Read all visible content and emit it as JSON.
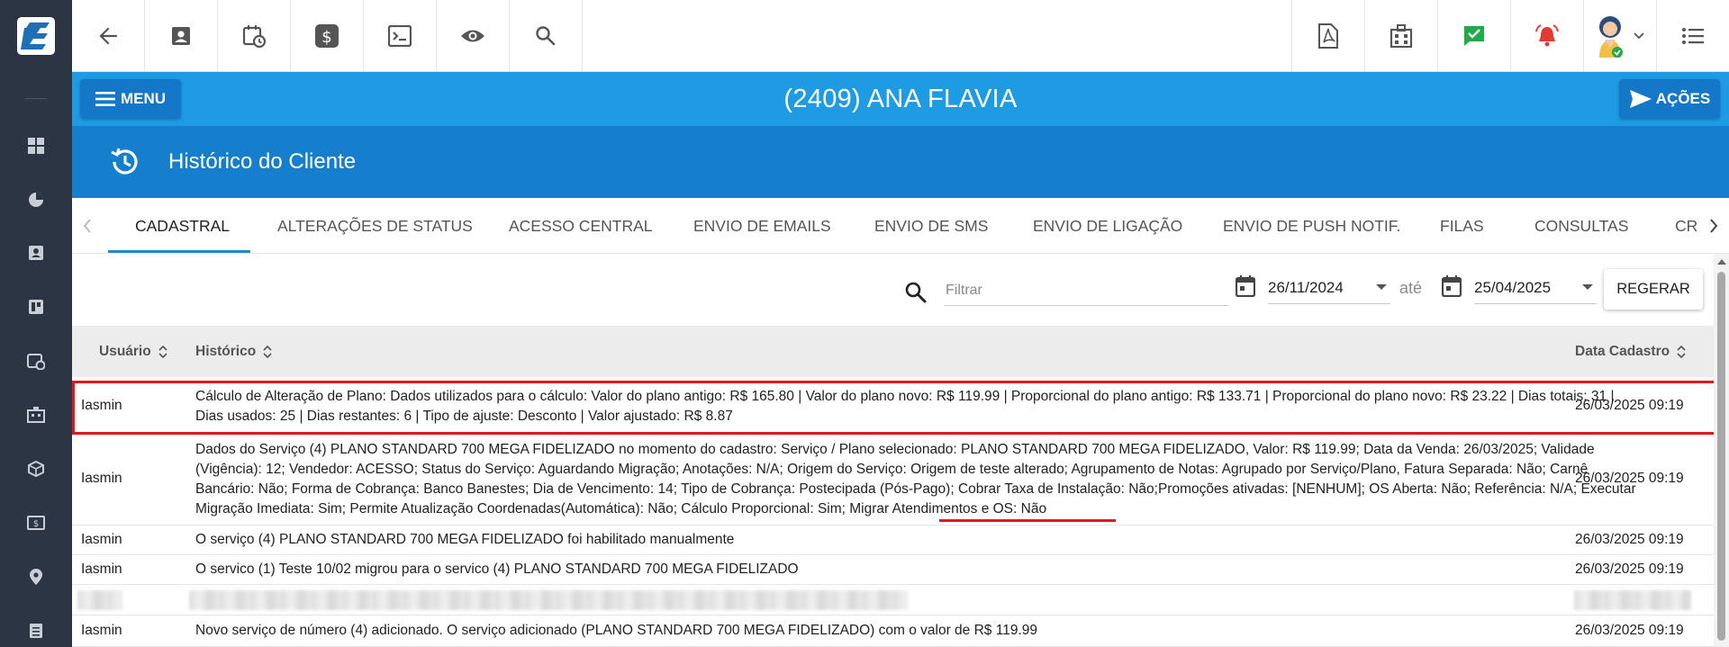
{
  "topbar": {
    "left_buttons": [
      {
        "icon": "arrow-left-icon"
      },
      {
        "icon": "contact-card-icon"
      },
      {
        "icon": "calendar-clock-icon"
      },
      {
        "icon": "dollar-icon"
      },
      {
        "icon": "terminal-icon"
      },
      {
        "icon": "eye-icon"
      },
      {
        "icon": "search-icon"
      }
    ],
    "right_buttons": [
      {
        "icon": "pdf-file-icon"
      },
      {
        "icon": "building-icon"
      },
      {
        "icon": "checkmark-message-icon",
        "color": "#22a94a"
      },
      {
        "icon": "alarm-bell-icon",
        "color": "#e53935"
      },
      {
        "icon": "avatar-icon"
      },
      {
        "icon": "list-icon"
      }
    ]
  },
  "header": {
    "menu_label": "MENU",
    "client_title": "(2409) ANA FLAVIA",
    "actions_label": "AÇÕES",
    "section_title": "Histórico do Cliente"
  },
  "tabs": [
    {
      "label": "CADASTRAL",
      "active": true
    },
    {
      "label": "ALTERAÇÕES DE STATUS"
    },
    {
      "label": "ACESSO CENTRAL"
    },
    {
      "label": "ENVIO DE EMAILS"
    },
    {
      "label": "ENVIO DE SMS"
    },
    {
      "label": "ENVIO DE LIGAÇÃO"
    },
    {
      "label": "ENVIO DE PUSH NOTIF."
    },
    {
      "label": "FILAS"
    },
    {
      "label": "CONSULTAS"
    },
    {
      "label": "CR"
    }
  ],
  "filter": {
    "placeholder": "Filtrar",
    "date_from": "26/11/2024",
    "date_sep": "até",
    "date_to": "25/04/2025",
    "regenerate_label": "REGERAR"
  },
  "table": {
    "columns": {
      "user": "Usuário",
      "history": "Histórico",
      "date": "Data Cadastro"
    },
    "rows": [
      {
        "user": "Iasmin",
        "history": "Cálculo de Alteração de Plano: Dados utilizados para o cálculo: Valor do plano antigo: R$ 165.80 | Valor do plano novo: R$ 119.99 | Proporcional do plano antigo: R$ 133.71 | Proporcional do plano novo: R$ 23.22 | Dias totais: 31 | Dias usados: 25 | Dias restantes: 6 | Tipo de ajuste: Desconto | Valor ajustado: R$ 8.87",
        "date": "26/03/2025 09:19",
        "highlighted": true
      },
      {
        "user": "Iasmin",
        "history": "Dados do Serviço (4) PLANO STANDARD 700 MEGA FIDELIZADO no momento do cadastro: Serviço / Plano selecionado: PLANO STANDARD 700 MEGA FIDELIZADO, Valor: R$ 119.99; Data da Venda: 26/03/2025; Validade (Vigência): 12; Vendedor: ACESSO; Status do Serviço: Aguardando Migração; Anotações: N/A; Origem do Serviço: Origem de teste alterado; Agrupamento de Notas: Agrupado por Serviço/Plano, Fatura Separada: Não; Carnê Bancário: Não; Forma de Cobrança: Banco Banestes; Dia de Vencimento: 14; Tipo de Cobrança: Postecipada (Pós-Pago); Cobrar Taxa de Instalação: Não;Promoções ativadas: [NENHUM]; OS Aberta: Não; Referência: N/A; Executar Migração Imediata: Sim; Permite Atualização Coordenadas(Automática): Não; Cálculo Proporcional: Sim; Migrar Atendimentos e OS: Não",
        "date": "26/03/2025 09:19"
      },
      {
        "user": "Iasmin",
        "history": "O serviço (4) PLANO STANDARD 700 MEGA FIDELIZADO foi habilitado manualmente",
        "date": "26/03/2025 09:19"
      },
      {
        "user": "Iasmin",
        "history": "O servico (1) Teste 10/02 migrou para o servico (4) PLANO STANDARD 700 MEGA FIDELIZADO",
        "date": "26/03/2025 09:19"
      },
      {
        "user": "Iasmin",
        "history": "Novo serviço de número (4) adicionado. O serviço adicionado (PLANO STANDARD 700 MEGA FIDELIZADO) com o valor de R$ 119.99",
        "date": "26/03/2025 09:19"
      }
    ]
  },
  "colors": {
    "sidebar": "#2b3543",
    "header_blue": "#1e9be3",
    "subheader_blue": "#167fcd",
    "button_blue": "#1577c7",
    "highlight_red": "#e0191c"
  }
}
